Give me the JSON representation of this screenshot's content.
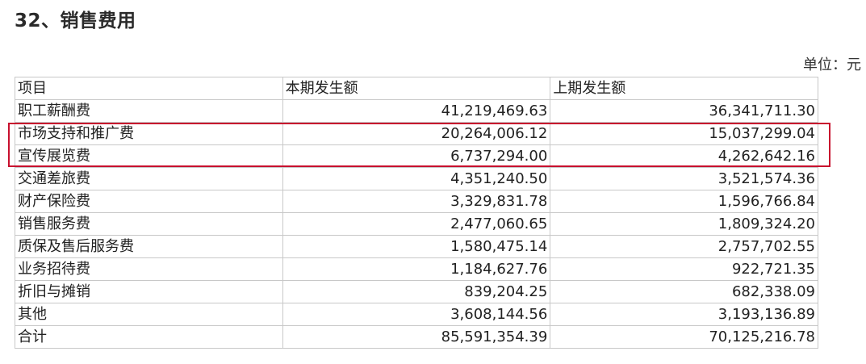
{
  "title": "32、销售费用",
  "unit_label": "单位：元",
  "header": [
    "项目",
    "本期发生额",
    "上期发生额"
  ],
  "rows": [
    {
      "item": "职工薪酬费",
      "current": "41,219,469.63",
      "prior": "36,341,711.30"
    },
    {
      "item": "市场支持和推广费",
      "current": "20,264,006.12",
      "prior": "15,037,299.04"
    },
    {
      "item": "宣传展览费",
      "current": "6,737,294.00",
      "prior": "4,262,642.16"
    },
    {
      "item": "交通差旅费",
      "current": "4,351,240.50",
      "prior": "3,521,574.36"
    },
    {
      "item": "财产保险费",
      "current": "3,329,831.78",
      "prior": "1,596,766.84"
    },
    {
      "item": "销售服务费",
      "current": "2,477,060.65",
      "prior": "1,809,324.20"
    },
    {
      "item": "质保及售后服务费",
      "current": "1,580,475.14",
      "prior": "2,757,702.55"
    },
    {
      "item": "业务招待费",
      "current": "1,184,627.76",
      "prior": "922,721.35"
    },
    {
      "item": "折旧与摊销",
      "current": "839,204.25",
      "prior": "682,338.09"
    },
    {
      "item": "其他",
      "current": "3,608,144.56",
      "prior": "3,193,136.89"
    },
    {
      "item": "合计",
      "current": "85,591,354.39",
      "prior": "70,125,216.78"
    }
  ],
  "highlight_color": "#c8102e"
}
